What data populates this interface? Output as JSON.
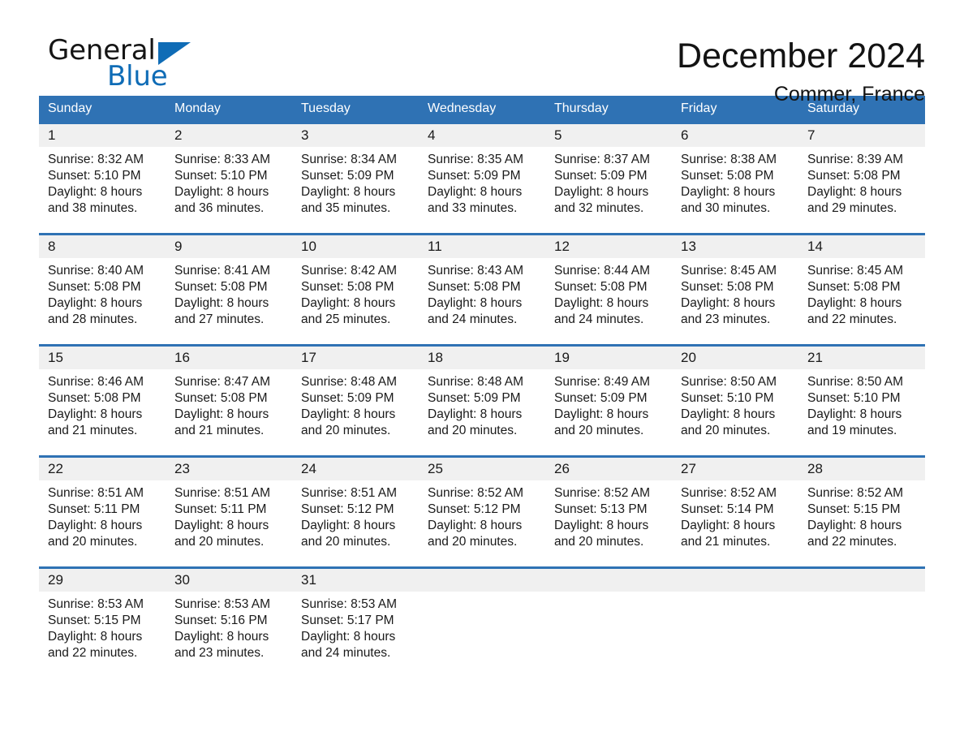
{
  "brand": {
    "word_one": "General",
    "word_two": "Blue",
    "triangle_icon": "brand-triangle-icon",
    "accent_color": "#0f6cb6"
  },
  "header": {
    "title": "December 2024",
    "subtitle": "Commer, France"
  },
  "theme": {
    "header_blue": "#2f72b4",
    "daynum_band": "#f0f0f0",
    "text": "#1a1a1a",
    "page_background": "#ffffff"
  },
  "weekdays": [
    "Sunday",
    "Monday",
    "Tuesday",
    "Wednesday",
    "Thursday",
    "Friday",
    "Saturday"
  ],
  "weeks": [
    {
      "days": [
        {
          "date": "1",
          "sunrise": "Sunrise: 8:32 AM",
          "sunset": "Sunset: 5:10 PM",
          "daylight_1": "Daylight: 8 hours",
          "daylight_2": "and 38 minutes."
        },
        {
          "date": "2",
          "sunrise": "Sunrise: 8:33 AM",
          "sunset": "Sunset: 5:10 PM",
          "daylight_1": "Daylight: 8 hours",
          "daylight_2": "and 36 minutes."
        },
        {
          "date": "3",
          "sunrise": "Sunrise: 8:34 AM",
          "sunset": "Sunset: 5:09 PM",
          "daylight_1": "Daylight: 8 hours",
          "daylight_2": "and 35 minutes."
        },
        {
          "date": "4",
          "sunrise": "Sunrise: 8:35 AM",
          "sunset": "Sunset: 5:09 PM",
          "daylight_1": "Daylight: 8 hours",
          "daylight_2": "and 33 minutes."
        },
        {
          "date": "5",
          "sunrise": "Sunrise: 8:37 AM",
          "sunset": "Sunset: 5:09 PM",
          "daylight_1": "Daylight: 8 hours",
          "daylight_2": "and 32 minutes."
        },
        {
          "date": "6",
          "sunrise": "Sunrise: 8:38 AM",
          "sunset": "Sunset: 5:08 PM",
          "daylight_1": "Daylight: 8 hours",
          "daylight_2": "and 30 minutes."
        },
        {
          "date": "7",
          "sunrise": "Sunrise: 8:39 AM",
          "sunset": "Sunset: 5:08 PM",
          "daylight_1": "Daylight: 8 hours",
          "daylight_2": "and 29 minutes."
        }
      ]
    },
    {
      "days": [
        {
          "date": "8",
          "sunrise": "Sunrise: 8:40 AM",
          "sunset": "Sunset: 5:08 PM",
          "daylight_1": "Daylight: 8 hours",
          "daylight_2": "and 28 minutes."
        },
        {
          "date": "9",
          "sunrise": "Sunrise: 8:41 AM",
          "sunset": "Sunset: 5:08 PM",
          "daylight_1": "Daylight: 8 hours",
          "daylight_2": "and 27 minutes."
        },
        {
          "date": "10",
          "sunrise": "Sunrise: 8:42 AM",
          "sunset": "Sunset: 5:08 PM",
          "daylight_1": "Daylight: 8 hours",
          "daylight_2": "and 25 minutes."
        },
        {
          "date": "11",
          "sunrise": "Sunrise: 8:43 AM",
          "sunset": "Sunset: 5:08 PM",
          "daylight_1": "Daylight: 8 hours",
          "daylight_2": "and 24 minutes."
        },
        {
          "date": "12",
          "sunrise": "Sunrise: 8:44 AM",
          "sunset": "Sunset: 5:08 PM",
          "daylight_1": "Daylight: 8 hours",
          "daylight_2": "and 24 minutes."
        },
        {
          "date": "13",
          "sunrise": "Sunrise: 8:45 AM",
          "sunset": "Sunset: 5:08 PM",
          "daylight_1": "Daylight: 8 hours",
          "daylight_2": "and 23 minutes."
        },
        {
          "date": "14",
          "sunrise": "Sunrise: 8:45 AM",
          "sunset": "Sunset: 5:08 PM",
          "daylight_1": "Daylight: 8 hours",
          "daylight_2": "and 22 minutes."
        }
      ]
    },
    {
      "days": [
        {
          "date": "15",
          "sunrise": "Sunrise: 8:46 AM",
          "sunset": "Sunset: 5:08 PM",
          "daylight_1": "Daylight: 8 hours",
          "daylight_2": "and 21 minutes."
        },
        {
          "date": "16",
          "sunrise": "Sunrise: 8:47 AM",
          "sunset": "Sunset: 5:08 PM",
          "daylight_1": "Daylight: 8 hours",
          "daylight_2": "and 21 minutes."
        },
        {
          "date": "17",
          "sunrise": "Sunrise: 8:48 AM",
          "sunset": "Sunset: 5:09 PM",
          "daylight_1": "Daylight: 8 hours",
          "daylight_2": "and 20 minutes."
        },
        {
          "date": "18",
          "sunrise": "Sunrise: 8:48 AM",
          "sunset": "Sunset: 5:09 PM",
          "daylight_1": "Daylight: 8 hours",
          "daylight_2": "and 20 minutes."
        },
        {
          "date": "19",
          "sunrise": "Sunrise: 8:49 AM",
          "sunset": "Sunset: 5:09 PM",
          "daylight_1": "Daylight: 8 hours",
          "daylight_2": "and 20 minutes."
        },
        {
          "date": "20",
          "sunrise": "Sunrise: 8:50 AM",
          "sunset": "Sunset: 5:10 PM",
          "daylight_1": "Daylight: 8 hours",
          "daylight_2": "and 20 minutes."
        },
        {
          "date": "21",
          "sunrise": "Sunrise: 8:50 AM",
          "sunset": "Sunset: 5:10 PM",
          "daylight_1": "Daylight: 8 hours",
          "daylight_2": "and 19 minutes."
        }
      ]
    },
    {
      "days": [
        {
          "date": "22",
          "sunrise": "Sunrise: 8:51 AM",
          "sunset": "Sunset: 5:11 PM",
          "daylight_1": "Daylight: 8 hours",
          "daylight_2": "and 20 minutes."
        },
        {
          "date": "23",
          "sunrise": "Sunrise: 8:51 AM",
          "sunset": "Sunset: 5:11 PM",
          "daylight_1": "Daylight: 8 hours",
          "daylight_2": "and 20 minutes."
        },
        {
          "date": "24",
          "sunrise": "Sunrise: 8:51 AM",
          "sunset": "Sunset: 5:12 PM",
          "daylight_1": "Daylight: 8 hours",
          "daylight_2": "and 20 minutes."
        },
        {
          "date": "25",
          "sunrise": "Sunrise: 8:52 AM",
          "sunset": "Sunset: 5:12 PM",
          "daylight_1": "Daylight: 8 hours",
          "daylight_2": "and 20 minutes."
        },
        {
          "date": "26",
          "sunrise": "Sunrise: 8:52 AM",
          "sunset": "Sunset: 5:13 PM",
          "daylight_1": "Daylight: 8 hours",
          "daylight_2": "and 20 minutes."
        },
        {
          "date": "27",
          "sunrise": "Sunrise: 8:52 AM",
          "sunset": "Sunset: 5:14 PM",
          "daylight_1": "Daylight: 8 hours",
          "daylight_2": "and 21 minutes."
        },
        {
          "date": "28",
          "sunrise": "Sunrise: 8:52 AM",
          "sunset": "Sunset: 5:15 PM",
          "daylight_1": "Daylight: 8 hours",
          "daylight_2": "and 22 minutes."
        }
      ]
    },
    {
      "days": [
        {
          "date": "29",
          "sunrise": "Sunrise: 8:53 AM",
          "sunset": "Sunset: 5:15 PM",
          "daylight_1": "Daylight: 8 hours",
          "daylight_2": "and 22 minutes."
        },
        {
          "date": "30",
          "sunrise": "Sunrise: 8:53 AM",
          "sunset": "Sunset: 5:16 PM",
          "daylight_1": "Daylight: 8 hours",
          "daylight_2": "and 23 minutes."
        },
        {
          "date": "31",
          "sunrise": "Sunrise: 8:53 AM",
          "sunset": "Sunset: 5:17 PM",
          "daylight_1": "Daylight: 8 hours",
          "daylight_2": "and 24 minutes."
        },
        {
          "date": "",
          "sunrise": "",
          "sunset": "",
          "daylight_1": "",
          "daylight_2": ""
        },
        {
          "date": "",
          "sunrise": "",
          "sunset": "",
          "daylight_1": "",
          "daylight_2": ""
        },
        {
          "date": "",
          "sunrise": "",
          "sunset": "",
          "daylight_1": "",
          "daylight_2": ""
        },
        {
          "date": "",
          "sunrise": "",
          "sunset": "",
          "daylight_1": "",
          "daylight_2": ""
        }
      ]
    }
  ]
}
